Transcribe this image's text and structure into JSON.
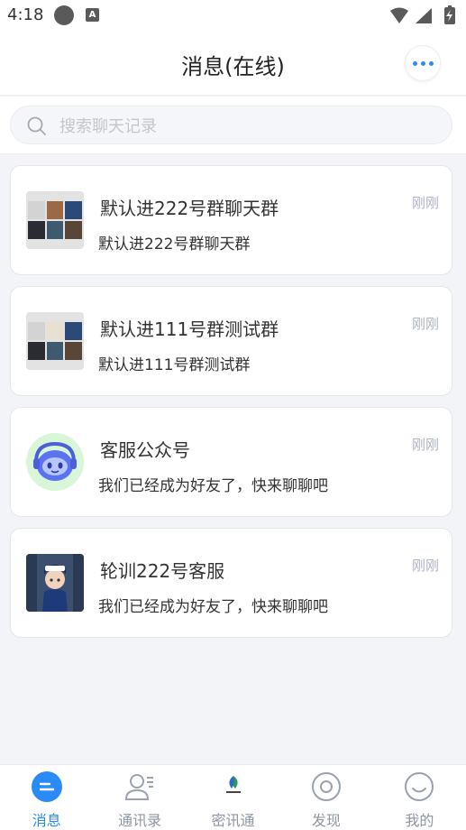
{
  "status_bar": {
    "time": "4:18",
    "notification_letter": "A"
  },
  "header": {
    "title": "消息(在线)",
    "more_icon": "more-dots-icon"
  },
  "search": {
    "placeholder": "搜索聊天记录",
    "value": ""
  },
  "conversations": [
    {
      "title": "默认进222号群聊天群",
      "preview": "默认进222号群聊天群",
      "time": "刚刚",
      "avatar": "group-avatar"
    },
    {
      "title": "默认进111号群测试群",
      "preview": "默认进111号群测试群",
      "time": "刚刚",
      "avatar": "group-avatar"
    },
    {
      "title": "客服公众号",
      "preview": "我们已经成为好友了，快来聊聊吧",
      "time": "刚刚",
      "avatar": "robot-avatar"
    },
    {
      "title": "轮训222号客服",
      "preview": "我们已经成为好友了，快来聊聊吧",
      "time": "刚刚",
      "avatar": "photo-avatar"
    }
  ],
  "tabbar": {
    "items": [
      {
        "label": "消息",
        "icon": "chat-icon",
        "active": true
      },
      {
        "label": "通讯录",
        "icon": "contacts-icon",
        "active": false
      },
      {
        "label": "密讯通",
        "icon": "app-logo-icon",
        "active": false
      },
      {
        "label": "发现",
        "icon": "discover-icon",
        "active": false
      },
      {
        "label": "我的",
        "icon": "profile-icon",
        "active": false
      }
    ]
  },
  "colors": {
    "accent": "#2a8af6",
    "inactive": "#8f96a6",
    "time": "#aeb4c4",
    "background": "#f3f4f8"
  }
}
